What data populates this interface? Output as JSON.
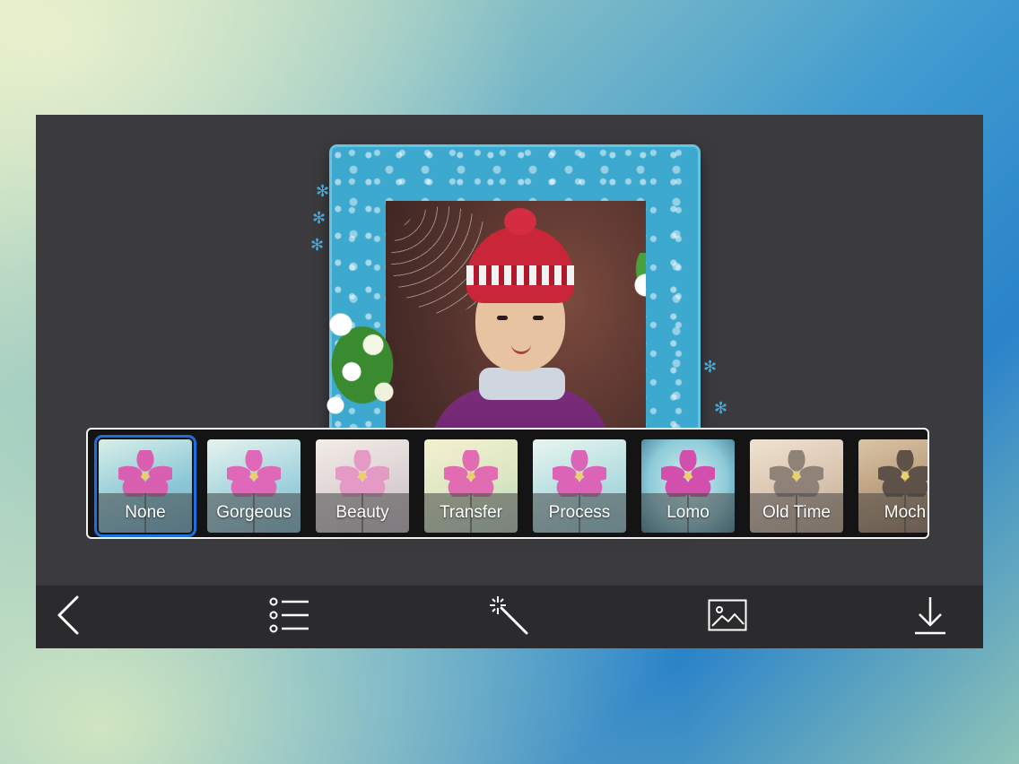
{
  "app": {
    "accent_color": "#1e6fe0",
    "frame_color": "#3ea9cf"
  },
  "filters": {
    "selected": "None",
    "items": [
      {
        "label": "None",
        "tone": "natural"
      },
      {
        "label": "Gorgeous",
        "tone": "cool"
      },
      {
        "label": "Beauty",
        "tone": "soft"
      },
      {
        "label": "Transfer",
        "tone": "warm"
      },
      {
        "label": "Process",
        "tone": "natural"
      },
      {
        "label": "Lomo",
        "tone": "cool"
      },
      {
        "label": "Old Time",
        "tone": "sepia"
      },
      {
        "label": "Moch",
        "tone": "sepia-dark"
      }
    ]
  },
  "toolbar": {
    "items": [
      {
        "name": "back",
        "icon": "chevron-left-icon"
      },
      {
        "name": "frames-list",
        "icon": "list-icon"
      },
      {
        "name": "effects",
        "icon": "magic-wand-icon"
      },
      {
        "name": "photo",
        "icon": "image-icon"
      },
      {
        "name": "save",
        "icon": "download-icon"
      }
    ]
  }
}
